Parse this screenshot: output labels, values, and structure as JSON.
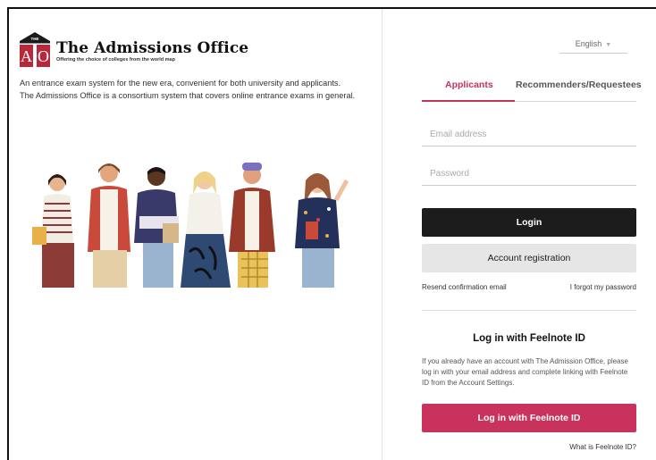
{
  "brand": {
    "mark_letters": "AO",
    "mark_top": "THE",
    "title": "The Admissions Office",
    "tagline": "Offering the choice of colleges from the world map"
  },
  "intro": {
    "line1": "An entrance exam system for the new era, convenient for both university and applicants.",
    "line2": "The Admissions Office is a consortium system that covers online entrance exams in general."
  },
  "language": {
    "selected": "English"
  },
  "tabs": [
    {
      "label": "Applicants",
      "active": true
    },
    {
      "label": "Recommenders/Requestees",
      "active": false
    }
  ],
  "form": {
    "email_placeholder": "Email address",
    "password_placeholder": "Password",
    "login_label": "Login",
    "register_label": "Account registration",
    "resend_label": "Resend confirmation email",
    "forgot_label": "I forgot my password"
  },
  "feelnote": {
    "title": "Log in with Feelnote ID",
    "description": "If you already have an account with The Admission Office, please log in with your email address and complete linking with Feelnote ID from the Account Settings.",
    "button_label": "Log in with Feelnote ID",
    "what_label": "What is Feelnote ID?"
  },
  "colors": {
    "accent": "#c2335a",
    "feelnote_button": "#c8325c",
    "login_button": "#1c1c1c",
    "register_button": "#e6e6e6",
    "logo_red": "#b8283a"
  }
}
